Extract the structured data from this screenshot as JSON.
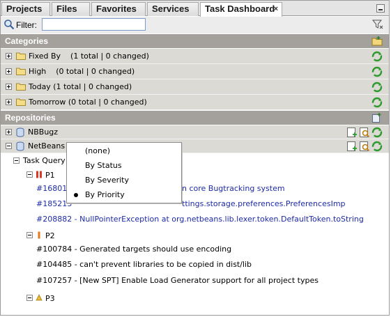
{
  "tabs": [
    {
      "label": "Projects"
    },
    {
      "label": "Files"
    },
    {
      "label": "Favorites"
    },
    {
      "label": "Services"
    },
    {
      "label": "Task Dashboard",
      "close": "×"
    }
  ],
  "filter": {
    "label": "Filter:",
    "value": ""
  },
  "categories": {
    "header": "Categories",
    "items": [
      {
        "label": "Fixed By    (1 total | 0 changed)"
      },
      {
        "label": "High    (0 total | 0 changed)"
      },
      {
        "label": "Today (1 total | 0 changed)"
      },
      {
        "label": "Tomorrow (0 total | 0 changed)"
      }
    ]
  },
  "repositories": {
    "header": "Repositories",
    "items": [
      {
        "label": "NBBugz"
      },
      {
        "label": "NetBeans"
      }
    ]
  },
  "tree": {
    "query": "Task Query",
    "groups": [
      {
        "label": "P1",
        "tasks": [
          {
            "text": "#168018",
            "tail": "n core Bugtracking system"
          },
          {
            "text": "#185213",
            "tail": "ttings.storage.preferences.PreferencesImp"
          },
          {
            "text": "#208882 - NullPointerException at org.netbeans.lib.lexer.token.DefaultToken.toString"
          }
        ]
      },
      {
        "label": "P2",
        "tasks": [
          {
            "text": "#100784 - Generated targets should use encoding"
          },
          {
            "text": "#104485 - can't prevent libraries to be copied in dist/lib"
          },
          {
            "text": "#107257 - [New SPT] Enable Load Generator support for all project types"
          }
        ]
      },
      {
        "label": "P3",
        "tasks": []
      }
    ]
  },
  "popup_menu": {
    "items": [
      {
        "label": "(none)"
      },
      {
        "label": "By Status"
      },
      {
        "label": "By Severity"
      },
      {
        "label": "By Priority",
        "selected": true
      }
    ]
  },
  "colors": {
    "section_header": "#a4a19c",
    "row_bg": "#dcdad5",
    "link": "#1d2aa6",
    "refresh_green": "#2e9a2e"
  }
}
